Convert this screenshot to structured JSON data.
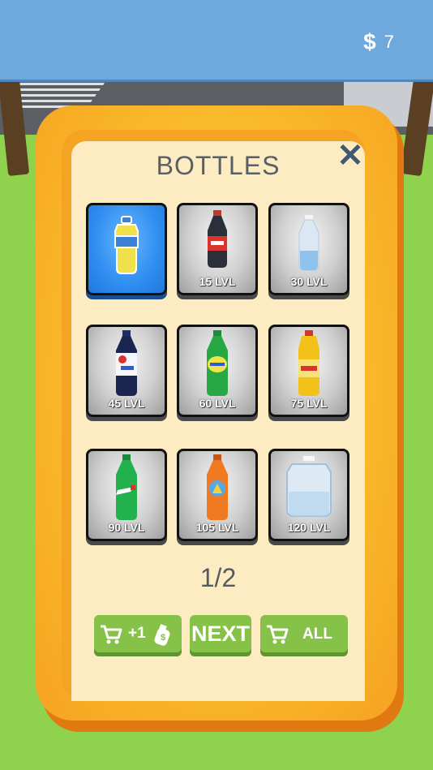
{
  "hud": {
    "currency_icon": "dollar-icon",
    "currency_symbol": "$",
    "money": "7"
  },
  "panel": {
    "title": "BOTTLES",
    "close_icon": "close-icon",
    "close_symbol": "✕"
  },
  "bottles": [
    {
      "name": "yellow-blue-bottle",
      "level": "",
      "selected": true
    },
    {
      "name": "cola-bottle",
      "level": "15 LVL",
      "selected": false
    },
    {
      "name": "clear-water-bottle",
      "level": "30 LVL",
      "selected": false
    },
    {
      "name": "blue-soda-bottle",
      "level": "45 LVL",
      "selected": false
    },
    {
      "name": "green-soda-bottle",
      "level": "60 LVL",
      "selected": false
    },
    {
      "name": "yellow-juice-bottle",
      "level": "75 LVL",
      "selected": false
    },
    {
      "name": "green-lemon-bottle",
      "level": "90 LVL",
      "selected": false
    },
    {
      "name": "orange-soda-bottle",
      "level": "105 LVL",
      "selected": false
    },
    {
      "name": "water-jug",
      "level": "120 LVL",
      "selected": false
    }
  ],
  "pagination": {
    "label": "1/2"
  },
  "buttons": {
    "buy_one": {
      "icon": "cart-icon",
      "label": "+1",
      "coin_icon": "coin-icon"
    },
    "next": {
      "label": "NEXT"
    },
    "buy_all": {
      "icon": "cart-icon",
      "label": "ALL"
    }
  },
  "colors": {
    "accent_green": "#86c247",
    "selected_blue": "#2f8ef0",
    "frame_orange": "#f5a322",
    "topbar_blue": "#6fa8dc"
  }
}
